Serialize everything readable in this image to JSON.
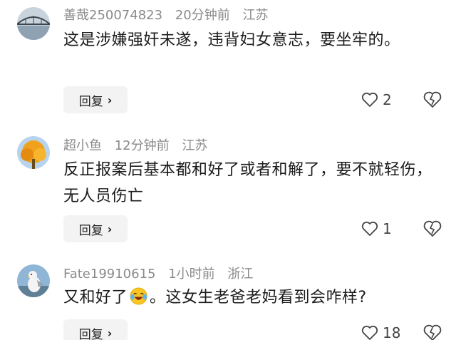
{
  "comments": [
    {
      "username": "善哉250074823",
      "time": "20分钟前",
      "location": "江苏",
      "text": "这是涉嫌强奸未遂，违背妇女意志，要坐牢的。",
      "reply_label": "回复",
      "likes": "2",
      "avatar_icon": "bridge-photo-avatar"
    },
    {
      "username": "超小鱼",
      "time": "12分钟前",
      "location": "江苏",
      "text": "反正报案后基本都和好了或者和解了，要不就轻伤，无人员伤亡",
      "reply_label": "回复",
      "likes": "1",
      "avatar_icon": "autumn-tree-avatar"
    },
    {
      "username": "Fate19910615",
      "time": "1小时前",
      "location": "浙江",
      "text_before": "又和好了",
      "text_after": "。这女生老爸老妈看到会咋样?",
      "emoji_icon": "laughing-crying-emoji",
      "reply_label": "回复",
      "likes": "18",
      "avatar_icon": "seagull-photo-avatar"
    }
  ],
  "colors": {
    "meta_text": "#8a8a8a",
    "body_text": "#1b1b1b",
    "reply_bg": "#f3f3f3"
  }
}
